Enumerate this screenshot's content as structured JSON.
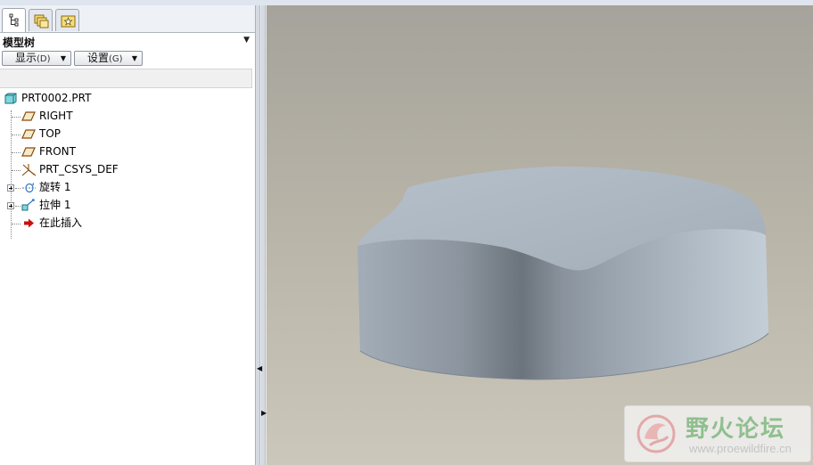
{
  "panel": {
    "tabs": [
      {
        "name": "model-tree",
        "icon": "tree-hierarchy-icon",
        "active": true
      },
      {
        "name": "folder-browser",
        "icon": "folders-icon",
        "active": false
      },
      {
        "name": "favorites",
        "icon": "favorites-star-icon",
        "active": false
      }
    ],
    "title": "模型树",
    "buttons": {
      "display_label": "显示",
      "display_key": "(D)",
      "settings_label": "设置",
      "settings_key": "(G)"
    },
    "tree": [
      {
        "label": "PRT0002.PRT",
        "icon": "part-cube-icon",
        "expandable": false
      },
      {
        "label": "RIGHT",
        "icon": "datum-plane-icon",
        "expandable": false
      },
      {
        "label": "TOP",
        "icon": "datum-plane-icon",
        "expandable": false
      },
      {
        "label": "FRONT",
        "icon": "datum-plane-icon",
        "expandable": false
      },
      {
        "label": "PRT_CSYS_DEF",
        "icon": "coordinate-system-icon",
        "expandable": false
      },
      {
        "label": "旋转 1",
        "icon": "revolve-feature-icon",
        "expandable": true
      },
      {
        "label": "拉伸 1",
        "icon": "extrude-feature-icon",
        "expandable": true
      },
      {
        "label": "在此插入",
        "icon": "insert-here-arrow-icon",
        "expandable": false
      }
    ]
  },
  "watermark": {
    "title": "野火论坛",
    "url": "www.proewildfire.cn"
  },
  "colors": {
    "model_top": "#a8b2bc",
    "model_side": "#8e97a1",
    "viewport_bg": "#b7b3a7",
    "insert_arrow": "#c81010",
    "watermark_text": "#8fbf8e"
  }
}
